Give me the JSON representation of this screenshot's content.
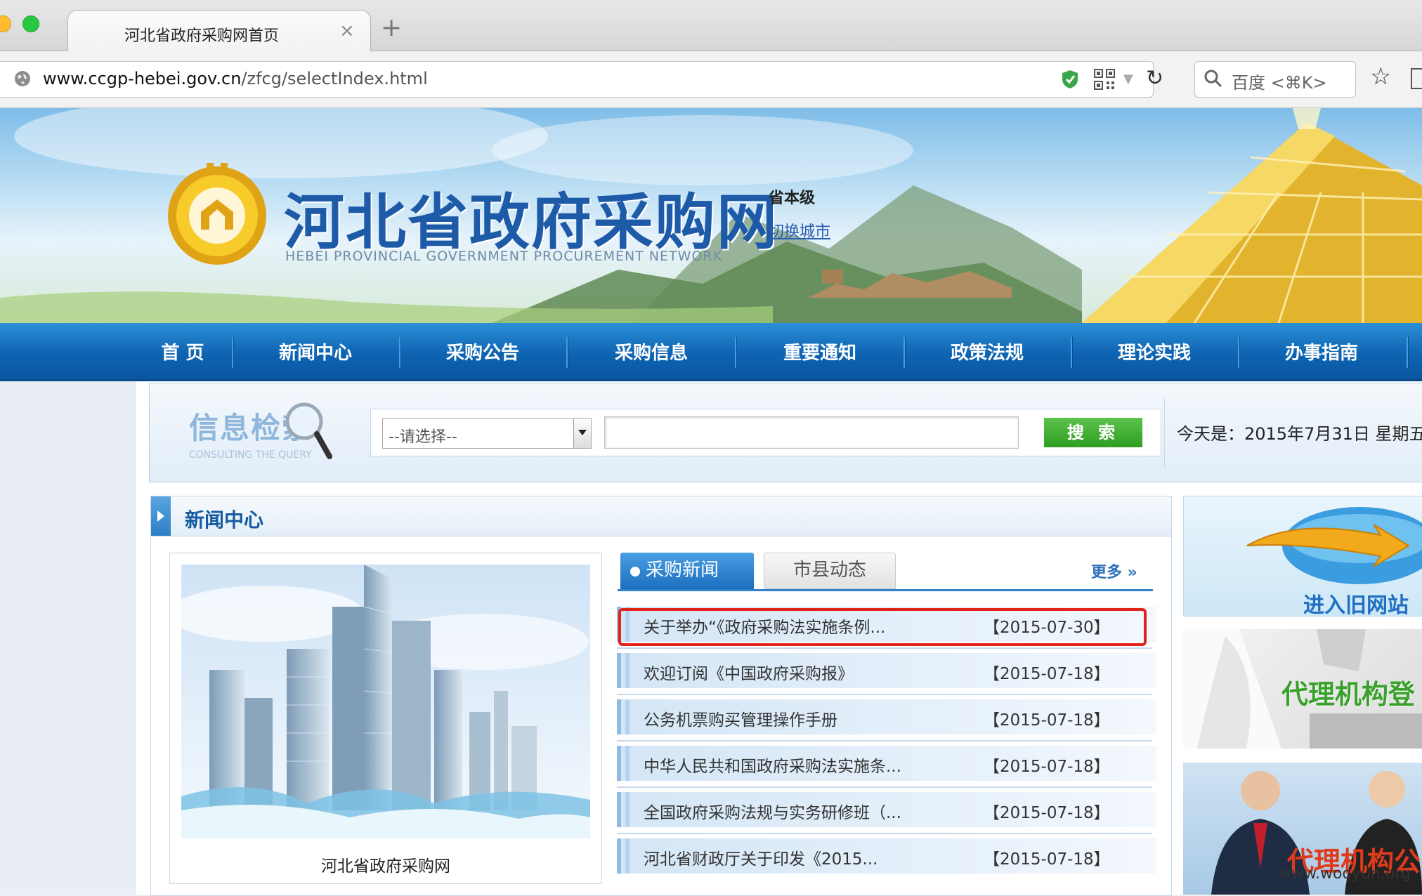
{
  "browser": {
    "tab_title": "河北省政府采购网首页",
    "tab_close": "×",
    "new_tab": "+",
    "url_host": "www.ccgp-hebei.gov.cn",
    "url_path": "/zfcg/selectIndex.html",
    "search_placeholder": "百度 <⌘K>",
    "colors": {
      "close": "#ff5f57",
      "minimize": "#febc2e",
      "zoom": "#28c840"
    }
  },
  "header": {
    "site_title": "河北省政府采购网",
    "site_subtitle": "HEBEI PROVINCIAL GOVERNMENT PROCUREMENT NETWORK",
    "level_label": "省本级",
    "switch_city": "切换城市"
  },
  "nav": {
    "items": [
      {
        "label": "首 页"
      },
      {
        "label": "新闻中心"
      },
      {
        "label": "采购公告"
      },
      {
        "label": "采购信息"
      },
      {
        "label": "重要通知"
      },
      {
        "label": "政策法规"
      },
      {
        "label": "理论实践"
      },
      {
        "label": "办事指南"
      }
    ]
  },
  "search": {
    "logo_text": "信息检索",
    "logo_subtext": "CONSULTING THE QUERY",
    "category_selected": "--请选择--",
    "button_label": "搜 索",
    "today": "今天是：2015年7月31日 星期五"
  },
  "news": {
    "section_title": "新闻中心",
    "photo_caption": "河北省政府采购网",
    "tabs": [
      {
        "label": "采购新闻"
      },
      {
        "label": "市县动态"
      }
    ],
    "more_label": "更多 »",
    "items": [
      {
        "title": "关于举办“《政府采购法实施条例...",
        "date": "【2015-07-30】"
      },
      {
        "title": "欢迎订阅《中国政府采购报》",
        "date": "【2015-07-18】"
      },
      {
        "title": "公务机票购买管理操作手册",
        "date": "【2015-07-18】"
      },
      {
        "title": "中华人民共和国政府采购法实施条...",
        "date": "【2015-07-18】"
      },
      {
        "title": "全国政府采购法规与实务研修班（...",
        "date": "【2015-07-18】"
      },
      {
        "title": "河北省财政厅关于印发《2015...",
        "date": "【2015-07-18】"
      }
    ]
  },
  "sidebar": {
    "old_site": "进入旧网站",
    "agency_register": "代理机构登",
    "agency_public": "代理机构公"
  },
  "watermark": "www.wooyun.org"
}
